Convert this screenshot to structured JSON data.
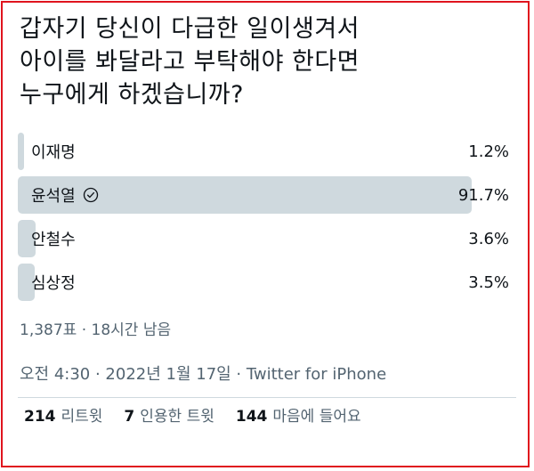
{
  "tweet": {
    "question": "갑자기 당신이 다급한 일이생겨서\n아이를 봐달라고 부탁해야 한다면\n누구에게 하겠습니까?",
    "poll": {
      "options": [
        {
          "label": "이재명",
          "percent": "1.2%",
          "value": 1.2,
          "winner": false
        },
        {
          "label": "윤석열",
          "percent": "91.7%",
          "value": 91.7,
          "winner": true
        },
        {
          "label": "안철수",
          "percent": "3.6%",
          "value": 3.6,
          "winner": false
        },
        {
          "label": "심상정",
          "percent": "3.5%",
          "value": 3.5,
          "winner": false
        }
      ],
      "summary": "1,387표 · 18시간 남음"
    },
    "timestamp": "오전 4:30 · 2022년 1월 17일 · Twitter for iPhone",
    "stats": {
      "retweets_count": "214",
      "retweets_label": "리트윗",
      "quotes_count": "7",
      "quotes_label": "인용한 트윗",
      "likes_count": "144",
      "likes_label": "마음에 들어요"
    }
  },
  "colors": {
    "bar": "#cfd9de",
    "frame": "#e0141e",
    "text": "#0f1419",
    "secondary_text": "#536471"
  },
  "icons": {
    "winner_marker": "check-circle-icon"
  }
}
